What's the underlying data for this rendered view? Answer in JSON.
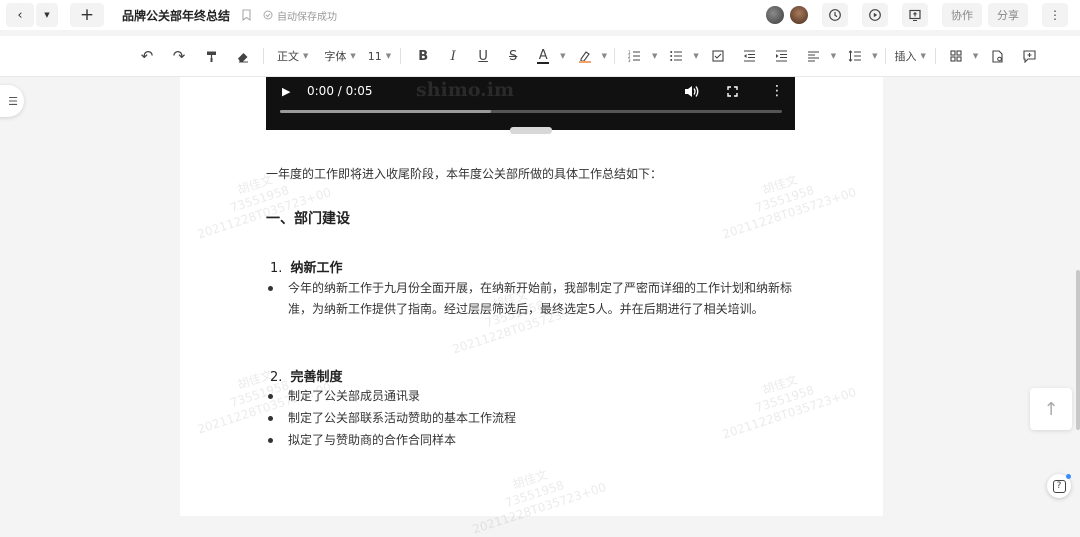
{
  "header": {
    "back_icon": "chevron-left-icon",
    "dropdown_icon": "caret-down-icon",
    "new_icon": "plus-icon",
    "doc_title": "品牌公关部年终总结",
    "bookmark_icon": "bookmark-icon",
    "autosave_text": "自动保存成功",
    "history_icon": "clock-history-icon",
    "play_icon": "play-circle-icon",
    "present_icon": "present-icon",
    "collaborate_label": "协作",
    "share_label": "分享",
    "more_icon": "more-vertical-icon"
  },
  "toolbar": {
    "undo": "↶",
    "redo": "↷",
    "format_painter": "format-painter-icon",
    "clear_format": "eraser-icon",
    "style_label": "正文",
    "font_label": "字体",
    "size_label": "11",
    "bold": "B",
    "italic": "I",
    "underline": "U",
    "strike": "S",
    "text_color": "A",
    "highlight": "highlight-icon",
    "insert_label": "插入"
  },
  "video": {
    "time": "0:00 / 0:05",
    "overlay_text": "shimo.im",
    "progress": 0.42
  },
  "content": {
    "intro": "一年度的工作即将进入收尾阶段，本年度公关部所做的具体工作总结如下：",
    "section_title": "一、部门建设",
    "sub1_num": "1.",
    "sub1_title": "纳新工作",
    "sub1_bullet": "今年的纳新工作于九月份全面开展，在纳新开始前，我部制定了严密而详细的工作计划和纳新标准，为纳新工作提供了指南。经过层层筛选后，最终选定5人。并在后期进行了相关培训。",
    "sub2_num": "2.",
    "sub2_title": "完善制度",
    "sub2_bullets": [
      "制定了公关部成员通讯录",
      "制定了公关部联系活动赞助的基本工作流程",
      "拟定了与赞助商的合作合同样本"
    ]
  },
  "watermark": {
    "name": "胡佳文",
    "id": "73551958",
    "stamp": "20211228T035723+00"
  }
}
